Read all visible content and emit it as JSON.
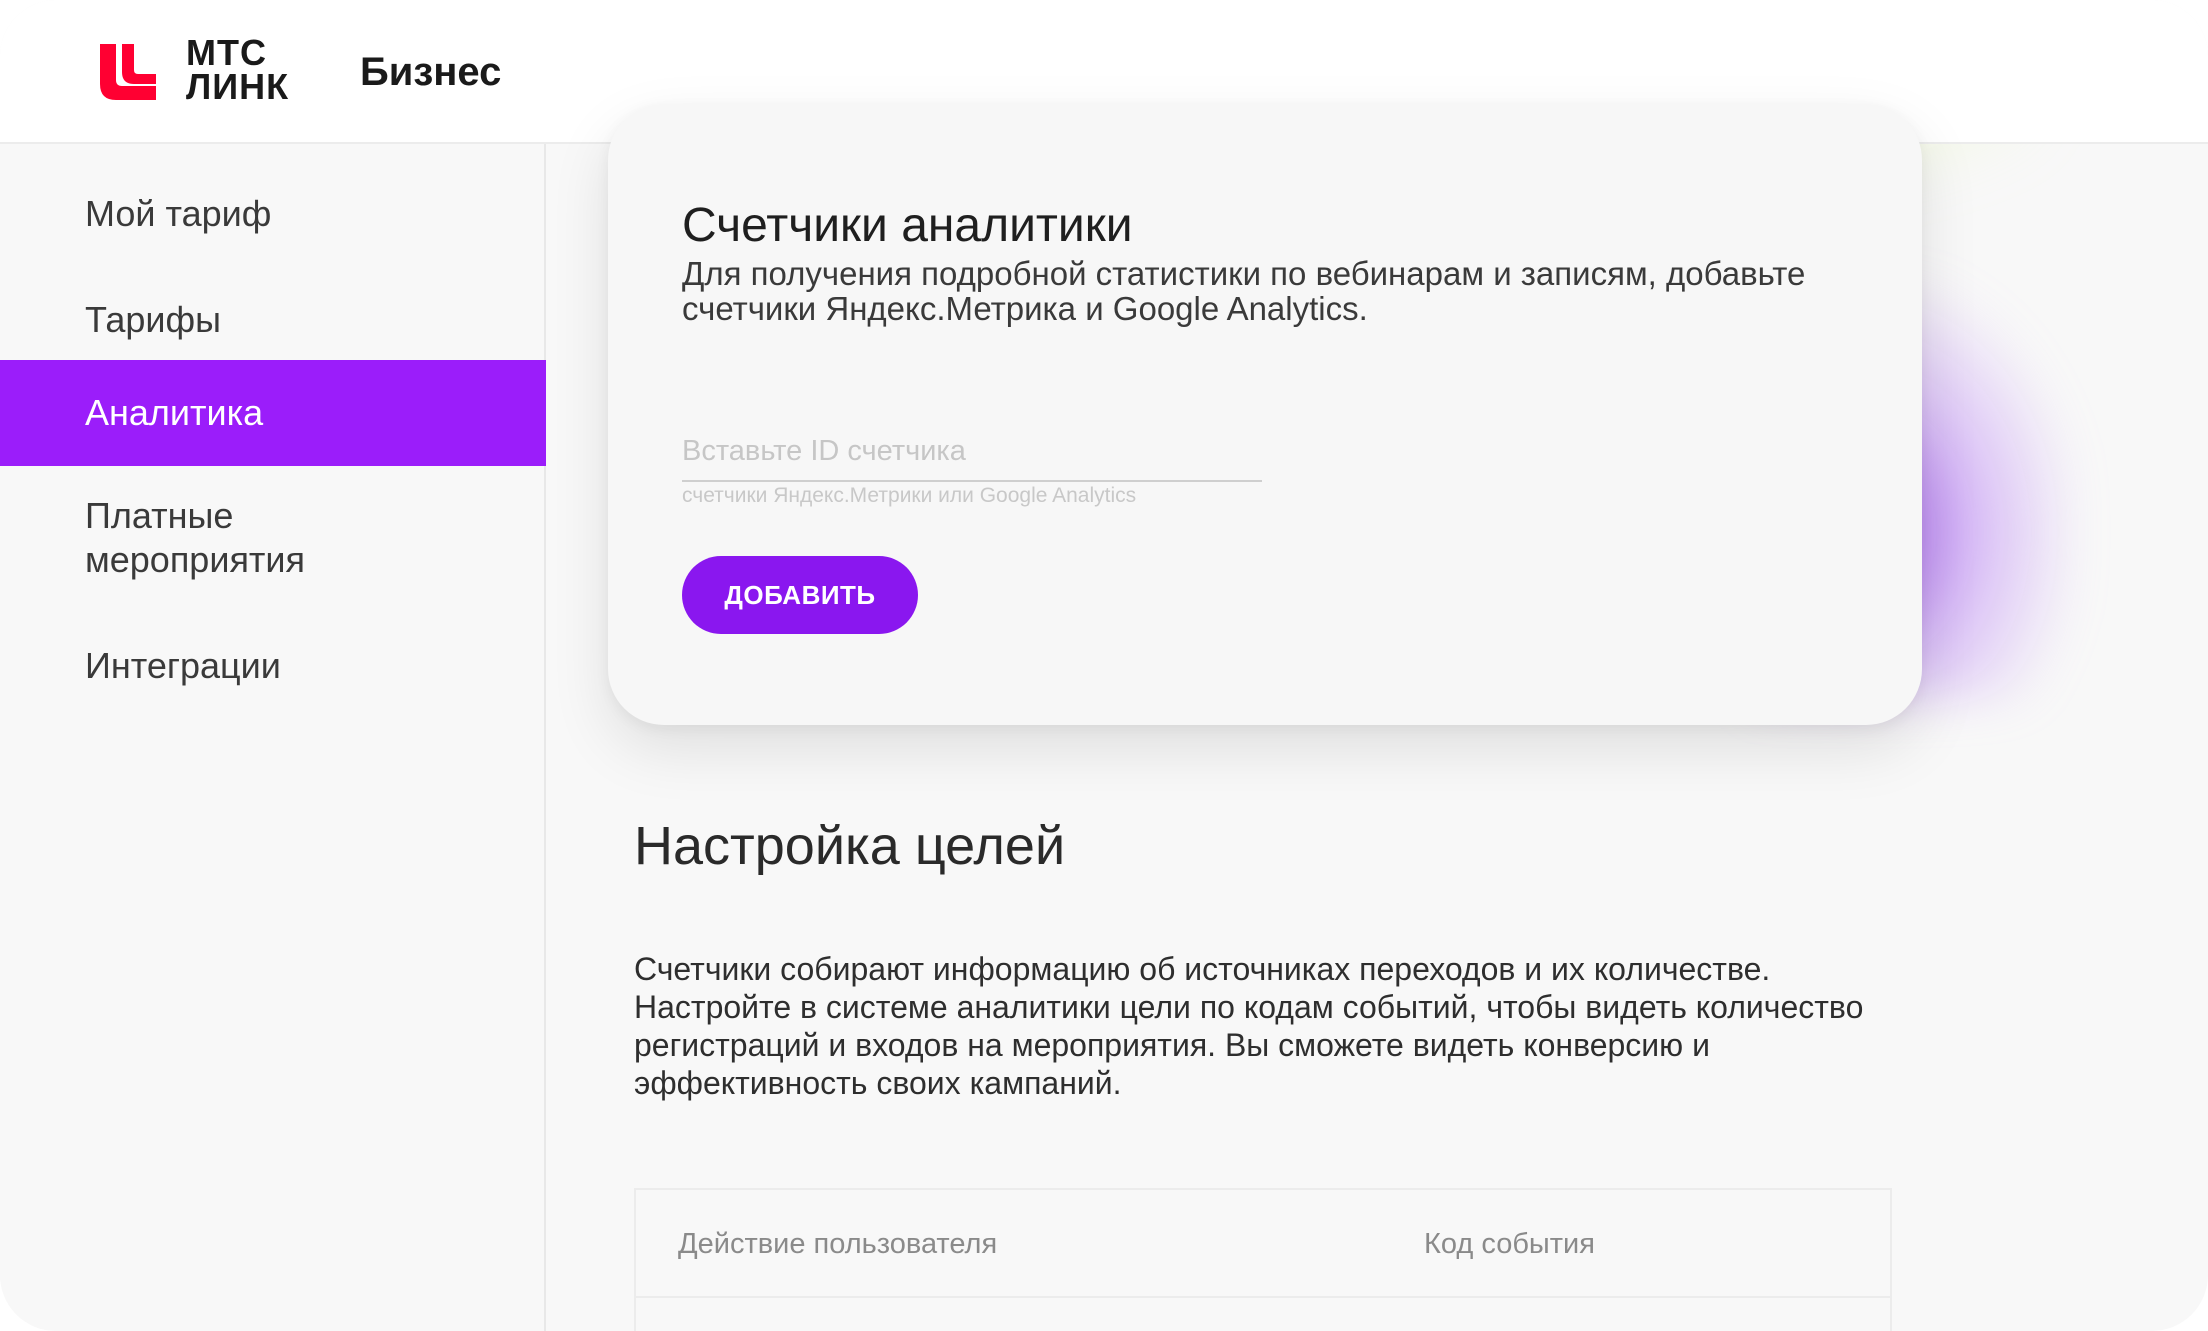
{
  "header": {
    "logo_line1": "МТС",
    "logo_line2": "ЛИНК",
    "brand_suffix": "Бизнес",
    "logo_color": "#ff0032"
  },
  "sidebar": {
    "items": [
      {
        "label": "Мой тариф",
        "active": false
      },
      {
        "label": "Тарифы",
        "active": false
      },
      {
        "label": "Аналитика",
        "active": true
      },
      {
        "label": "Платные мероприятия",
        "active": false
      },
      {
        "label": "Интеграции",
        "active": false
      }
    ],
    "active_color": "#9b1dfa"
  },
  "counters_card": {
    "title": "Счетчики аналитики",
    "description": "Для получения подробной статистики по вебинарам и записям, добавьте счетчики Яндекс.Метрика и Google Analytics.",
    "input_placeholder": "Вставьте ID счетчика",
    "input_value": "",
    "input_hint": "счетчики Яндекс.Метрики или Google Analytics",
    "add_button_label": "ДОБАВИТЬ",
    "button_color": "#8a17ef"
  },
  "goals": {
    "title": "Настройка целей",
    "text_lines": [
      "Счетчики собирают информацию об источниках переходов и их количестве.",
      "Настройте в системе аналитики цели по кодам событий, чтобы видеть количество",
      "регистраций и входов на мероприятия. Вы сможете видеть конверсию и",
      "эффективность своих кампаний."
    ],
    "table": {
      "columns": [
        "Действие пользователя",
        "Код события"
      ]
    }
  }
}
